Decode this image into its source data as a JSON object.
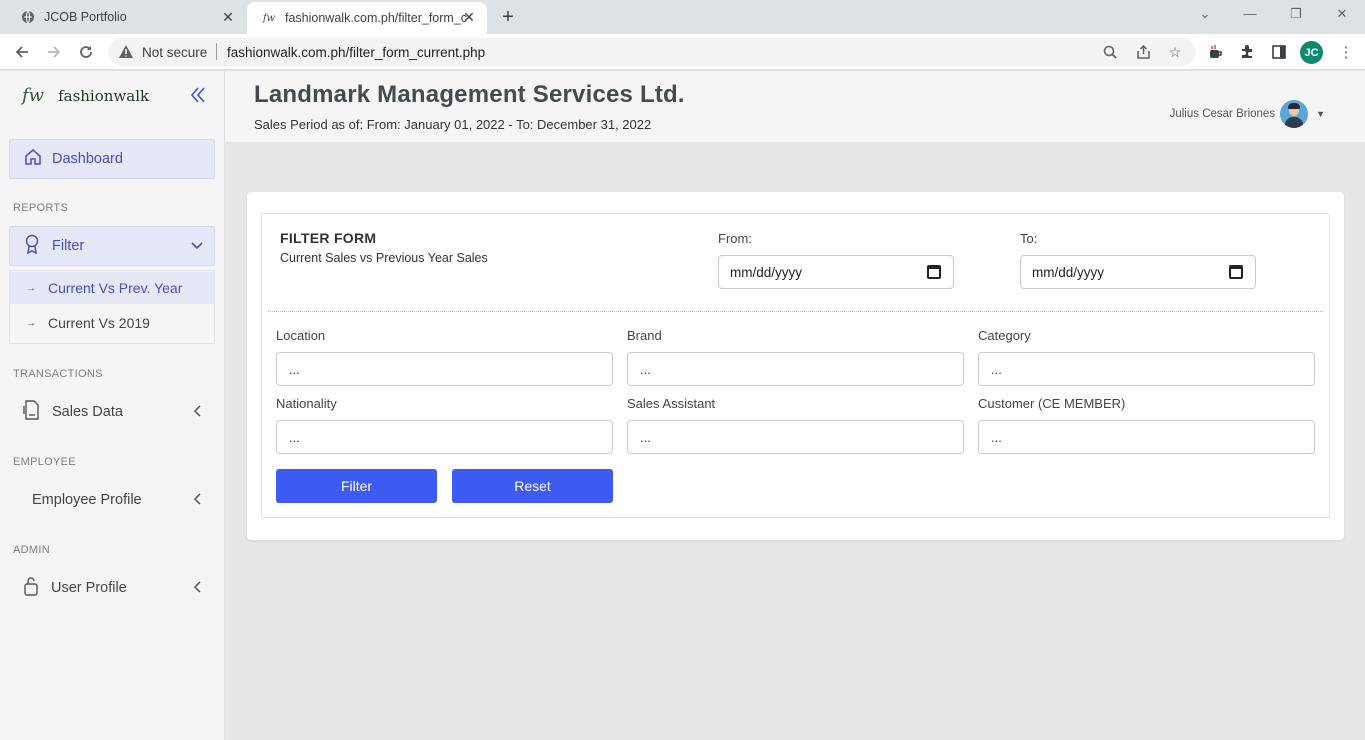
{
  "browser": {
    "tabs": [
      {
        "title": "JCOB Portfolio"
      },
      {
        "title": "fashionwalk.com.ph/filter_form_c"
      }
    ],
    "security_label": "Not secure",
    "url": "fashionwalk.com.ph/filter_form_current.php",
    "profile_initials": "JC"
  },
  "sidebar": {
    "logo": "fw",
    "brand": "fashionwalk",
    "dashboard": "Dashboard",
    "sections": {
      "reports": "REPORTS",
      "transactions": "TRANSACTIONS",
      "employee": "EMPLOYEE",
      "admin": "ADMIN"
    },
    "filter": "Filter",
    "submenu": [
      {
        "label": "Current Vs Prev. Year"
      },
      {
        "label": "Current Vs 2019"
      }
    ],
    "sales_data": "Sales Data",
    "employee_profile": "Employee Profile",
    "user_profile": "User Profile"
  },
  "header": {
    "company": "Landmark Management Services Ltd.",
    "period": "Sales Period as of: From: January 01, 2022 - To: December 31, 2022",
    "user_name": "Julius Cesar Briones"
  },
  "form": {
    "title": "FILTER FORM",
    "subtitle": "Current Sales vs Previous Year Sales",
    "from_label": "From:",
    "to_label": "To:",
    "date_placeholder": "mm/dd/yyyy",
    "fields": [
      {
        "label": "Location",
        "value": "..."
      },
      {
        "label": "Brand",
        "value": "..."
      },
      {
        "label": "Category",
        "value": "..."
      },
      {
        "label": "Nationality",
        "value": "..."
      },
      {
        "label": "Sales Assistant",
        "value": "..."
      },
      {
        "label": "Customer (CE MEMBER)",
        "value": "..."
      }
    ],
    "filter_button": "Filter",
    "reset_button": "Reset"
  }
}
